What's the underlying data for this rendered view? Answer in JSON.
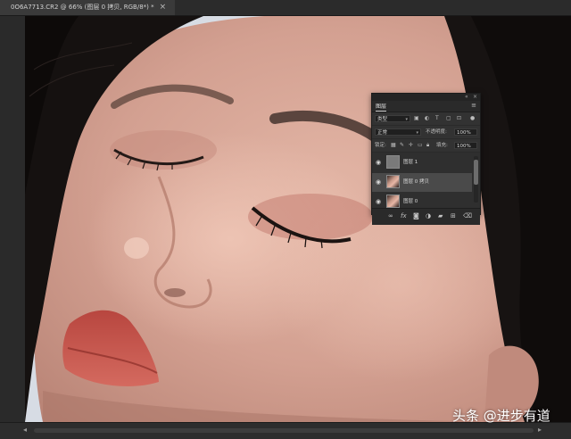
{
  "document_tab": {
    "title": "0O6A7713.CR2 @ 66% (图层 0 拷贝, RGB/8*) *",
    "close_glyph": "×"
  },
  "layers_panel": {
    "title": "图层",
    "menu_glyph": "≡",
    "collapse_glyph": "«",
    "close_glyph": "×",
    "filter_kind": "类型",
    "blend_mode": "正常",
    "opacity_label": "不透明度:",
    "opacity_value": "100%",
    "lock_label": "锁定:",
    "fill_label": "填充:",
    "fill_value": "100%",
    "layers": [
      {
        "name": "图层 1",
        "selected": false,
        "visible": true
      },
      {
        "name": "图层 0 拷贝",
        "selected": true,
        "visible": true
      },
      {
        "name": "图层 0",
        "selected": false,
        "visible": true
      }
    ],
    "footer_icons": [
      "link-icon",
      "fx-icon",
      "mask-icon",
      "adjustment-icon",
      "folder-icon",
      "new-layer-icon",
      "trash-icon"
    ],
    "fx_label": "fx"
  },
  "watermark": {
    "text": "头条 @进步有道"
  },
  "colors": {
    "ui_dark": "#282828",
    "panel_bg": "#323232",
    "selected_layer": "#4a4a4a",
    "skin": "#d4a898",
    "lips": "#c75a50",
    "hair": "#161210"
  }
}
